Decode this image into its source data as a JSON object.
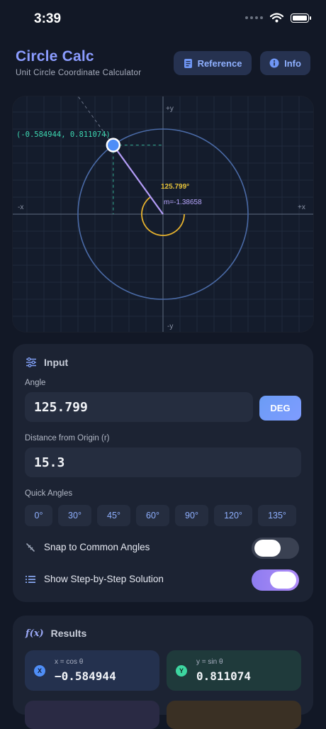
{
  "status": {
    "time": "3:39"
  },
  "header": {
    "title": "Circle Calc",
    "subtitle": "Unit Circle Coordinate Calculator",
    "reference_label": "Reference",
    "info_label": "Info"
  },
  "graph": {
    "axis_pos_y": "+y",
    "axis_neg_y": "-y",
    "axis_neg_x": "-x",
    "axis_pos_x": "+x",
    "point_label": "(-0.584944, 0.811074)",
    "angle_label": "125.799°",
    "slope_label": "m=-1.38658",
    "angle_deg": 125.799,
    "colors": {
      "ray": "#b39cf7",
      "arc": "#e6b22e",
      "point": "#4f8ef7",
      "label": "#3dd6b0"
    }
  },
  "input": {
    "section_title": "Input",
    "angle_label": "Angle",
    "angle_value": "125.799",
    "unit_button": "DEG",
    "distance_label": "Distance from Origin (r)",
    "distance_value": "15.3",
    "quick_label": "Quick Angles",
    "quick_angles": [
      "0°",
      "30°",
      "45°",
      "60°",
      "90°",
      "120°",
      "135°"
    ],
    "snap_label": "Snap to Common Angles",
    "snap_on": false,
    "steps_label": "Show Step-by-Step Solution",
    "steps_on": true
  },
  "results": {
    "section_title": "Results",
    "x_badge": "X",
    "x_label": "x = cos θ",
    "x_value": "−0.584944",
    "y_badge": "Y",
    "y_label": "y = sin θ",
    "y_value": "0.811074"
  }
}
